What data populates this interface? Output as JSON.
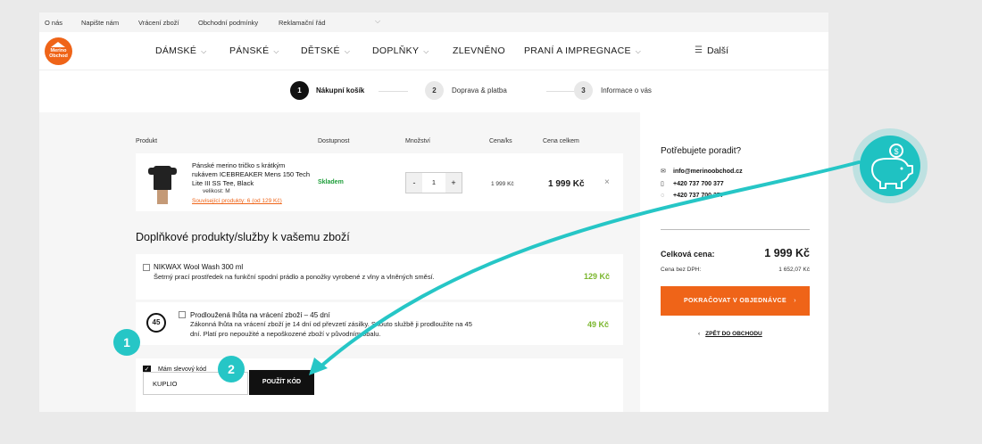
{
  "topbar": {
    "links": [
      "O nás",
      "Napište nám",
      "Vrácení zboží",
      "Obchodní podmínky",
      "Reklamační řád"
    ]
  },
  "logo": {
    "line1": "Merino",
    "line2": "Obchod",
    "color": "#ef6418"
  },
  "nav": {
    "items": [
      "DÁMSKÉ",
      "PÁNSKÉ",
      "DĚTSKÉ",
      "DOPLŇKY",
      "ZLEVNĚNO",
      "PRANÍ A IMPREGNACE"
    ],
    "more": "Další"
  },
  "steps": [
    {
      "num": "1",
      "label": "Nákupní košík"
    },
    {
      "num": "2",
      "label": "Doprava & platba"
    },
    {
      "num": "3",
      "label": "Informace o vás"
    }
  ],
  "cart": {
    "headers": {
      "product": "Produkt",
      "availability": "Dostupnost",
      "quantity": "Množství",
      "unit_price": "Cena/ks",
      "total_price": "Cena celkem"
    },
    "item": {
      "name": "Pánské merino tričko s krátkým rukávem ICEBREAKER Mens 150 Tech Lite III SS Tee, Black",
      "size": "velikost: M",
      "related": "Související produkty: 6 (od 129 Kč)",
      "availability": "Skladem",
      "quantity": "1",
      "minus": "-",
      "plus": "+",
      "unit_price": "1 999 Kč",
      "total_price": "1 999 Kč",
      "remove": "×"
    }
  },
  "addons": {
    "heading": "Doplňkové produkty/služby k vašemu zboží",
    "items": [
      {
        "title": "NIKWAX Wool Wash 300 ml",
        "desc": "Šetrný prací prostředek na funkční spodní prádlo a ponožky vyrobené z vlny a vlněných směsí.",
        "price": "129 Kč"
      },
      {
        "title": "Prodloužená lhůta na vrácení zboží – 45 dní",
        "desc": "Zákonná lhůta na vrácení zboží je 14 dní od převzetí zásilky. S touto službě ji prodloužíte na 45 dní. Platí pro nepoužité a nepoškozené zboží v původním obalu.",
        "price": "49 Kč",
        "badge": "45"
      }
    ]
  },
  "discount": {
    "label": "Mám slevový kód",
    "code": "KUPLIO",
    "apply": "POUŽÍT KÓD"
  },
  "sidebar": {
    "help_title": "Potřebujete poradit?",
    "email": "info@merinoobchod.cz",
    "phone1": "+420 737 700 377",
    "phone2": "+420 737 700 377",
    "total_label": "Celková cena:",
    "total_value": "1 999 Kč",
    "novat_label": "Cena bez DPH:",
    "novat_value": "1 652,07 Kč",
    "continue": "POKRAČOVAT V OBJEDNÁVCE",
    "back": "ZPĚT DO OBCHODU"
  },
  "annotations": {
    "one": "1",
    "two": "2"
  },
  "colors": {
    "accent": "#ef6418",
    "teal": "#26c6c6",
    "green": "#7ab62d",
    "stock": "#1e9e3a"
  }
}
